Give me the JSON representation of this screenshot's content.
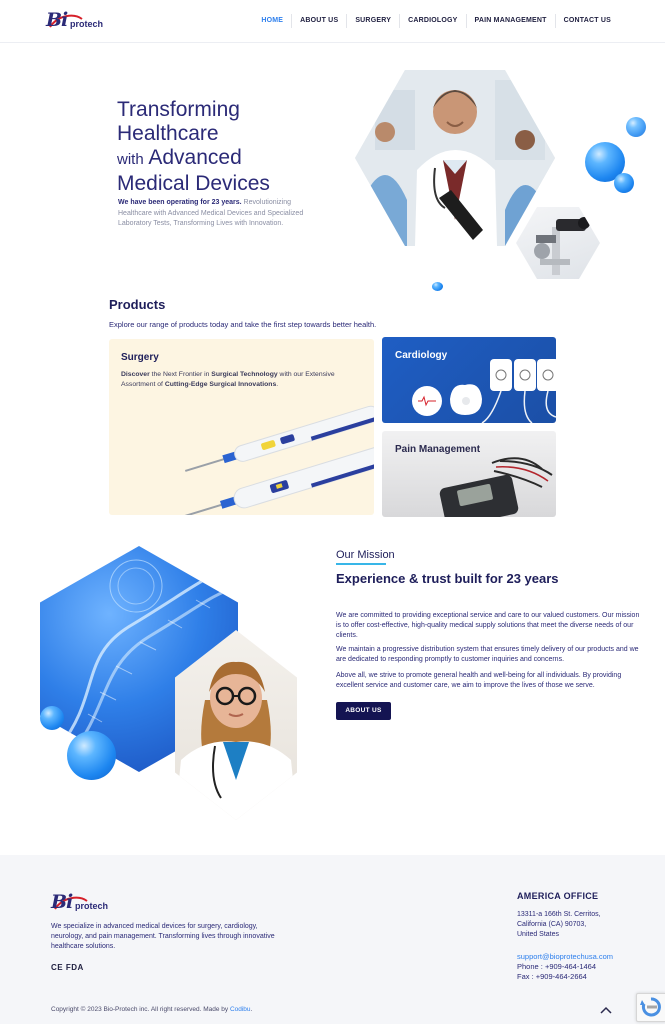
{
  "header": {
    "logo_initials": "Bi",
    "logo_word": "protech",
    "nav": [
      {
        "label": "HOME",
        "active": true
      },
      {
        "label": "ABOUT US"
      },
      {
        "label": "SURGERY"
      },
      {
        "label": "CARDIOLOGY"
      },
      {
        "label": "PAIN MANAGEMENT"
      },
      {
        "label": "CONTACT US"
      }
    ]
  },
  "hero": {
    "title_line1": "Transforming",
    "title_line2": "Healthcare",
    "title_with": "with",
    "title_line3": "Advanced",
    "title_line4": "Medical Devices",
    "desc_bold": "We have been operating for 23 years.",
    "desc_rest": "Revolutionizing Healthcare with Advanced Medical Devices and Specialized Laboratory Tests, Transforming Lives with Innovation."
  },
  "products": {
    "title": "Products",
    "subtitle": "Explore our range of products today and take the first step towards better health.",
    "surgery": {
      "title": "Surgery",
      "desc_1": "Discover",
      "desc_2": " the Next Frontier in ",
      "desc_3": "Surgical Technology",
      "desc_4": " with our Extensive Assortment of ",
      "desc_5": "Cutting-Edge Surgical Innovations",
      "desc_6": "."
    },
    "cardiology": {
      "title": "Cardiology"
    },
    "pain": {
      "title": "Pain Management"
    }
  },
  "mission": {
    "label": "Our Mission",
    "heading": "Experience & trust built for 23 years",
    "p1": "We are committed to providing exceptional service and care to our valued customers. Our mission is to offer cost-effective, high-quality medical supply solutions that meet the diverse needs of our clients.",
    "p2": "We maintain a progressive distribution system that ensures timely delivery of our products and we are dedicated to responding promptly to customer inquiries and concerns.",
    "p3": "Above all, we strive to promote general health and well-being for all individuals. By providing excellent service and customer care, we aim to improve the lives of those we serve.",
    "button": "ABOUT US"
  },
  "footer": {
    "logo_initials": "Bi",
    "logo_word": "protech",
    "desc": "We specialize in advanced medical devices for surgery, cardiology, neurology, and pain management. Transforming lives through innovative healthcare solutions.",
    "certs": "CE FDA",
    "office_title": "AMERICA OFFICE",
    "address_1": "13311-a 166th St. Cerritos,",
    "address_2": "California (CA) 90703,",
    "address_3": "United States",
    "email": "support@bioprotechusa.com",
    "phone": "Phone : +909-464-1464",
    "fax": "Fax : +909-464-2664",
    "copyright": "Copyright © 2023 Bio-Protech inc. All right reserved. Made by",
    "made_by": "Codibu",
    "copyright_end": "."
  },
  "icons": {
    "scroll_top": "chevron-up-icon",
    "recaptcha": "recaptcha-icon"
  },
  "colors": {
    "brand_navy": "#2b2a77",
    "accent_blue": "#2f80ed",
    "button_navy": "#141452",
    "surgery_card_bg": "#fdf5e2",
    "cardiology_card_bg": "#1f5ec4"
  }
}
